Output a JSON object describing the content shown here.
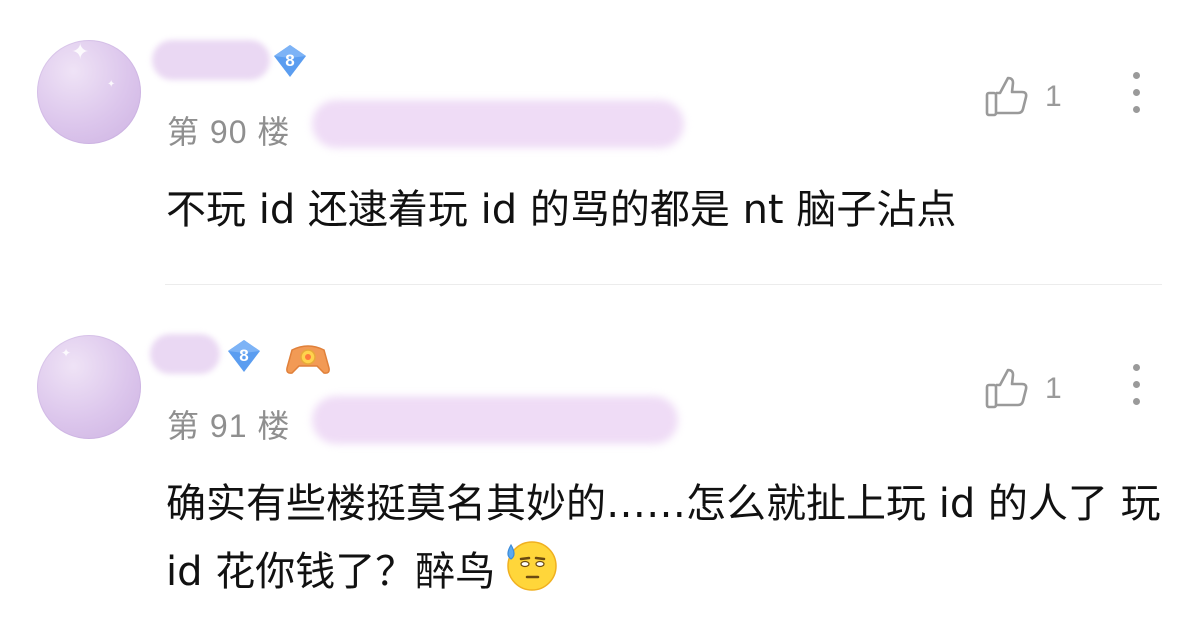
{
  "comments": [
    {
      "level": "8",
      "floor": "第 90 楼",
      "likes": "1",
      "text": "不玩 id 还逮着玩 id 的骂的都是 nt 脑子沾点",
      "has_extra_badge": false
    },
    {
      "level": "8",
      "floor": "第 91 楼",
      "likes": "1",
      "text": "确实有些楼挺莫名其妙的……怎么就扯上玩 id 的人了 玩 id 花你钱了？醉鸟",
      "has_extra_badge": true,
      "emoji": "sweat-face-emoji"
    }
  ],
  "colors": {
    "level_badge": "#5b9df0",
    "secondary_text": "#8f8f8f",
    "icon_gray": "#9a9a9a",
    "blur_pink": "#ead8f3"
  }
}
